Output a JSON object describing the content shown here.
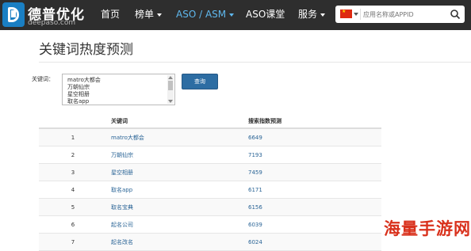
{
  "header": {
    "logo_title": "德普优化",
    "logo_subtitle": "deepaso.com",
    "nav": [
      {
        "label": "首页",
        "has_dropdown": false
      },
      {
        "label": "榜单",
        "has_dropdown": true
      },
      {
        "label": "ASO / ASM",
        "has_dropdown": true
      },
      {
        "label": "ASO课堂",
        "has_dropdown": false
      },
      {
        "label": "服务",
        "has_dropdown": true
      }
    ],
    "search": {
      "country": "China",
      "placeholder": "应用名称或APPID",
      "icon": "search-icon"
    },
    "colors": {
      "nav_bg": "#2e2e2e",
      "active": "#5fb8ee",
      "brand": "#1a7fc3"
    }
  },
  "page": {
    "title": "关键词热度预测",
    "keywords_label": "关键词：",
    "keywords_lines": [
      "matro大都会",
      "万朝仙宗",
      "星空相册",
      "取名app"
    ],
    "query_button": "查询"
  },
  "table": {
    "headers": [
      "关键词",
      "搜索指数预测"
    ],
    "rows": [
      {
        "rank": "1",
        "keyword": "matro大都会",
        "index": "6649"
      },
      {
        "rank": "2",
        "keyword": "万朝仙宗",
        "index": "7193"
      },
      {
        "rank": "3",
        "keyword": "星空相册",
        "index": "7459"
      },
      {
        "rank": "4",
        "keyword": "取名app",
        "index": "6171"
      },
      {
        "rank": "5",
        "keyword": "取名宝典",
        "index": "6156"
      },
      {
        "rank": "6",
        "keyword": "起名公司",
        "index": "6039"
      },
      {
        "rank": "7",
        "keyword": "起名改名",
        "index": "6024"
      }
    ]
  },
  "watermark": "海量手游网"
}
